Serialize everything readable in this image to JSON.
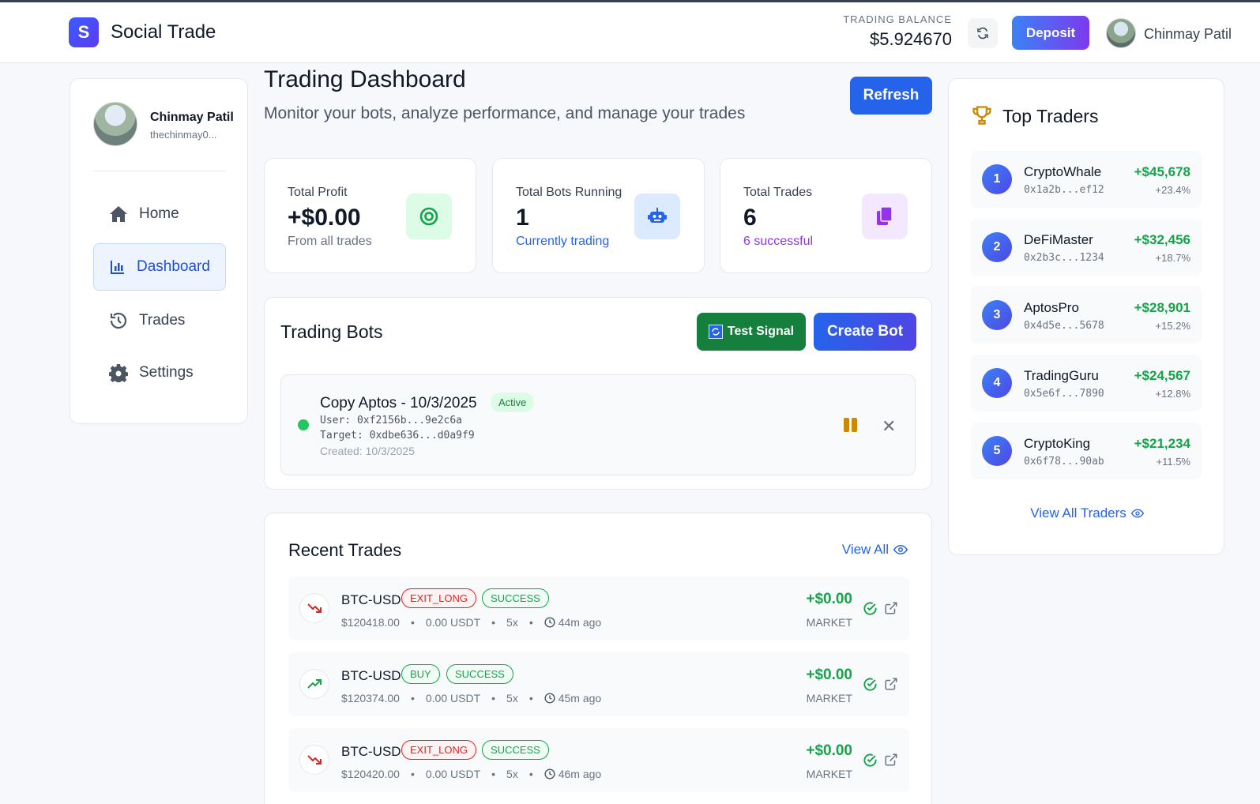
{
  "header": {
    "brand_letter": "S",
    "brand": "Social Trade",
    "balance_label": "TRADING BALANCE",
    "balance_value": "$5.924670",
    "deposit_label": "Deposit",
    "user_name": "Chinmay Patil"
  },
  "sidebar": {
    "name": "Chinmay Patil",
    "handle": "thechinmay0...",
    "items": [
      {
        "label": "Home",
        "icon": "home-icon"
      },
      {
        "label": "Dashboard",
        "icon": "bar-chart-icon",
        "active": true
      },
      {
        "label": "Trades",
        "icon": "history-icon"
      },
      {
        "label": "Settings",
        "icon": "gear-icon"
      }
    ]
  },
  "main": {
    "title": "Trading Dashboard",
    "subtitle": "Monitor your bots, analyze performance, and manage your trades",
    "refresh_label": "Refresh",
    "stats": [
      {
        "label": "Total Profit",
        "value": "+$0.00",
        "foot": "From all trades",
        "foot_color": "#6b7280",
        "icon": "target-icon",
        "icon_bg": "#dcfce7",
        "icon_color": "#16a34a"
      },
      {
        "label": "Total Bots Running",
        "value": "1",
        "foot": "Currently trading",
        "foot_color": "#2563eb",
        "icon": "robot-icon",
        "icon_bg": "#dbeafe",
        "icon_color": "#2563eb"
      },
      {
        "label": "Total Trades",
        "value": "6",
        "foot": "6 successful",
        "foot_color": "#9333ea",
        "icon": "copy-icon",
        "icon_bg": "#f3e8ff",
        "icon_color": "#9333ea"
      }
    ]
  },
  "bots": {
    "title": "Trading Bots",
    "test_signal_label": "Test Signal",
    "create_bot_label": "Create Bot",
    "items": [
      {
        "name": "Copy Aptos - 10/3/2025",
        "status": "Active",
        "user": "User: 0xf2156b...9e2c6a",
        "target": "Target: 0xdbe636...d0a9f9",
        "created": "Created: 10/3/2025"
      }
    ]
  },
  "trades": {
    "title": "Recent Trades",
    "view_all_label": "View All",
    "items": [
      {
        "pair": "BTC-USD",
        "side": "EXIT_LONG",
        "status": "SUCCESS",
        "price": "$120418.00",
        "amount": "0.00 USDT",
        "leverage": "5x",
        "time": "44m ago",
        "pnl": "+$0.00",
        "order_type": "MARKET",
        "direction": "down"
      },
      {
        "pair": "BTC-USD",
        "side": "BUY",
        "status": "SUCCESS",
        "price": "$120374.00",
        "amount": "0.00 USDT",
        "leverage": "5x",
        "time": "45m ago",
        "pnl": "+$0.00",
        "order_type": "MARKET",
        "direction": "up"
      },
      {
        "pair": "BTC-USD",
        "side": "EXIT_LONG",
        "status": "SUCCESS",
        "price": "$120420.00",
        "amount": "0.00 USDT",
        "leverage": "5x",
        "time": "46m ago",
        "pnl": "+$0.00",
        "order_type": "MARKET",
        "direction": "down"
      }
    ]
  },
  "top_traders": {
    "title": "Top Traders",
    "view_all_label": "View All Traders",
    "items": [
      {
        "rank": "1",
        "name": "CryptoWhale",
        "address": "0x1a2b...ef12",
        "profit": "+$45,678",
        "pct": "+23.4%"
      },
      {
        "rank": "2",
        "name": "DeFiMaster",
        "address": "0x2b3c...1234",
        "profit": "+$32,456",
        "pct": "+18.7%"
      },
      {
        "rank": "3",
        "name": "AptosPro",
        "address": "0x4d5e...5678",
        "profit": "+$28,901",
        "pct": "+15.2%"
      },
      {
        "rank": "4",
        "name": "TradingGuru",
        "address": "0x5e6f...7890",
        "profit": "+$24,567",
        "pct": "+12.8%"
      },
      {
        "rank": "5",
        "name": "CryptoKing",
        "address": "0x6f78...90ab",
        "profit": "+$21,234",
        "pct": "+11.5%"
      }
    ]
  }
}
